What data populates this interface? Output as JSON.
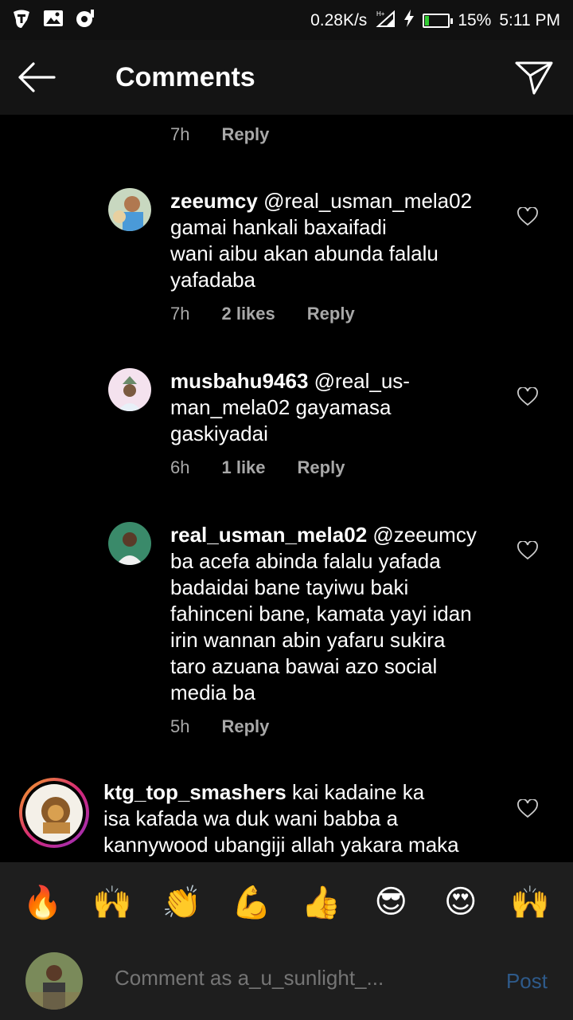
{
  "status_bar": {
    "left_icons": [
      "app-t-icon",
      "image-icon",
      "media-icon"
    ],
    "net_speed": "0.28K/s",
    "battery": "15%",
    "battery_level": 0.15,
    "time": "5:11 PM"
  },
  "header": {
    "title": "Comments",
    "back_icon": "arrow-left-icon",
    "share_icon": "send-icon"
  },
  "comments": [
    {
      "meta_time": "7h",
      "reply_label": "Reply"
    },
    {
      "username": "zeeumcy",
      "text_lines": [
        "@real_usman_mela02",
        "gamai hankali baxaifadi",
        "wani aibu akan abunda falalu",
        "yafadaba"
      ],
      "time": "7h",
      "likes": "2 likes",
      "reply_label": "Reply"
    },
    {
      "username": "musbahu9463",
      "text_lines": [
        "@real_us-",
        "man_mela02 gayamasa",
        "gaskiyadai"
      ],
      "time": "6h",
      "likes": "1 like",
      "reply_label": "Reply"
    },
    {
      "username": "real_usman_mela02",
      "text_lines": [
        "@zeeumcy",
        "ba acefa abinda falalu yafada",
        "badaidai bane tayiwu baki",
        "fahinceni bane, kamata yayi idan",
        "irin wannan abin yafaru sukira",
        "taro azuana bawai azo social",
        "media ba"
      ],
      "time": "5h",
      "reply_label": "Reply"
    },
    {
      "username": "ktg_top_smashers",
      "text_lines": [
        "kai kadaine ka",
        "isa kafada wa duk wani babba a",
        "kannywood ubangiji allah yakara maka"
      ]
    }
  ],
  "emoji_bar": [
    "🔥",
    "🙌",
    "👏",
    "💪",
    "👍",
    "😎",
    "😍",
    "🙌"
  ],
  "emoji_names": [
    "fire-emoji",
    "raised-hands-emoji",
    "clapping-hands-emoji",
    "flexed-biceps-emoji",
    "thumbs-up-emoji",
    "sunglasses-face-emoji",
    "heart-eyes-emoji",
    "raised-hands-face-emoji"
  ],
  "comment_box": {
    "placeholder": "Comment as a_u_sunlight_...",
    "post_label": "Post"
  }
}
